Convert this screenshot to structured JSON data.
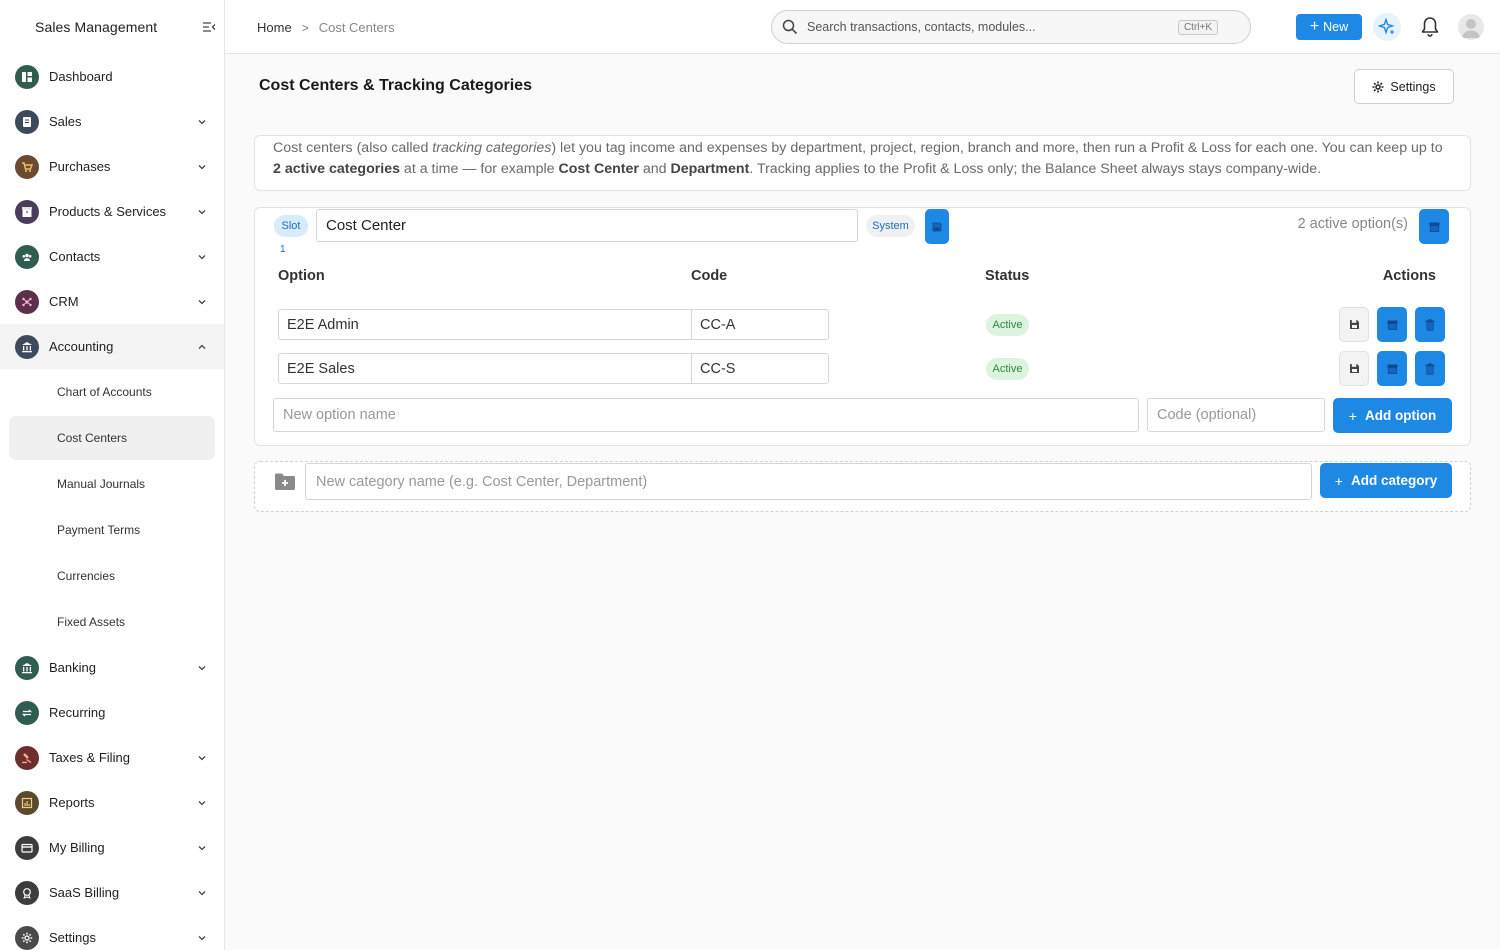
{
  "app": {
    "title": "Sales Management"
  },
  "sidebar": {
    "items": [
      {
        "label": "Dashboard",
        "icon": "dashboard-icon",
        "color": "#2f5d4f",
        "has_chevron": false
      },
      {
        "label": "Sales",
        "icon": "sales-icon",
        "color": "#3d4a5c",
        "has_chevron": true
      },
      {
        "label": "Purchases",
        "icon": "cart-icon",
        "color": "#6b4a2f",
        "has_chevron": true
      },
      {
        "label": "Products & Services",
        "icon": "box-icon",
        "color": "#4a3d5c",
        "has_chevron": true
      },
      {
        "label": "Contacts",
        "icon": "people-icon",
        "color": "#2f5d4f",
        "has_chevron": true
      },
      {
        "label": "CRM",
        "icon": "crm-icon",
        "color": "#5c2f4a",
        "has_chevron": true
      },
      {
        "label": "Accounting",
        "icon": "bank-icon",
        "color": "#3d4a5c",
        "has_chevron": true,
        "open": true
      }
    ],
    "accounting_sub": [
      {
        "label": "Chart of Accounts"
      },
      {
        "label": "Cost Centers",
        "active": true
      },
      {
        "label": "Manual Journals"
      },
      {
        "label": "Payment Terms"
      },
      {
        "label": "Currencies"
      },
      {
        "label": "Fixed Assets"
      }
    ],
    "items_after": [
      {
        "label": "Banking",
        "icon": "bank-icon",
        "color": "#2f5d4f",
        "has_chevron": true
      },
      {
        "label": "Recurring",
        "icon": "recurring-icon",
        "color": "#2f5d4f",
        "has_chevron": false
      },
      {
        "label": "Taxes & Filing",
        "icon": "gavel-icon",
        "color": "#6b2f2f",
        "has_chevron": true
      },
      {
        "label": "Reports",
        "icon": "report-icon",
        "color": "#5c4a2f",
        "has_chevron": true
      },
      {
        "label": "My Billing",
        "icon": "billing-icon",
        "color": "#3d3d3d",
        "has_chevron": true
      },
      {
        "label": "SaaS Billing",
        "icon": "badge-icon",
        "color": "#3d3d3d",
        "has_chevron": true
      },
      {
        "label": "Settings",
        "icon": "gear-icon",
        "color": "#4a4a4a",
        "has_chevron": true
      }
    ]
  },
  "topbar": {
    "breadcrumb": {
      "home": "Home",
      "sep": ">",
      "current": "Cost Centers"
    },
    "search": {
      "placeholder": "Search transactions, contacts, modules...",
      "shortcut": "Ctrl+K"
    },
    "new_label": "New",
    "accent": "#1e88e5"
  },
  "main": {
    "title": "Cost Centers & Tracking Categories",
    "settings_label": "Settings",
    "info": {
      "p1": "Cost centers (also called ",
      "p1_em": "tracking categories",
      "p2": ") let you tag income and expenses by department, project, region, branch and more, then run a Profit & Loss for each one. You can keep up to ",
      "b1": "2 active categories",
      "p3": " at a time — for example ",
      "b2": "Cost Center",
      "p4": " and ",
      "b3": "Department",
      "p5": ". Tracking applies to the Profit & Loss only; the Balance Sheet always stays company-wide."
    },
    "category": {
      "slot_label": "Slot",
      "slot_num": "1",
      "name": "Cost Center",
      "system_label": "System",
      "active_count": "2 active option(s)",
      "columns": {
        "option": "Option",
        "code": "Code",
        "status": "Status",
        "actions": "Actions"
      },
      "options": [
        {
          "name": "E2E Admin",
          "code": "CC-A",
          "status": "Active"
        },
        {
          "name": "E2E Sales",
          "code": "CC-S",
          "status": "Active"
        }
      ],
      "new_option_placeholder": "New option name",
      "code_placeholder": "Code (optional)",
      "add_option_label": "Add option"
    },
    "new_category": {
      "placeholder": "New category name (e.g. Cost Center, Department)",
      "add_label": "Add category"
    }
  }
}
